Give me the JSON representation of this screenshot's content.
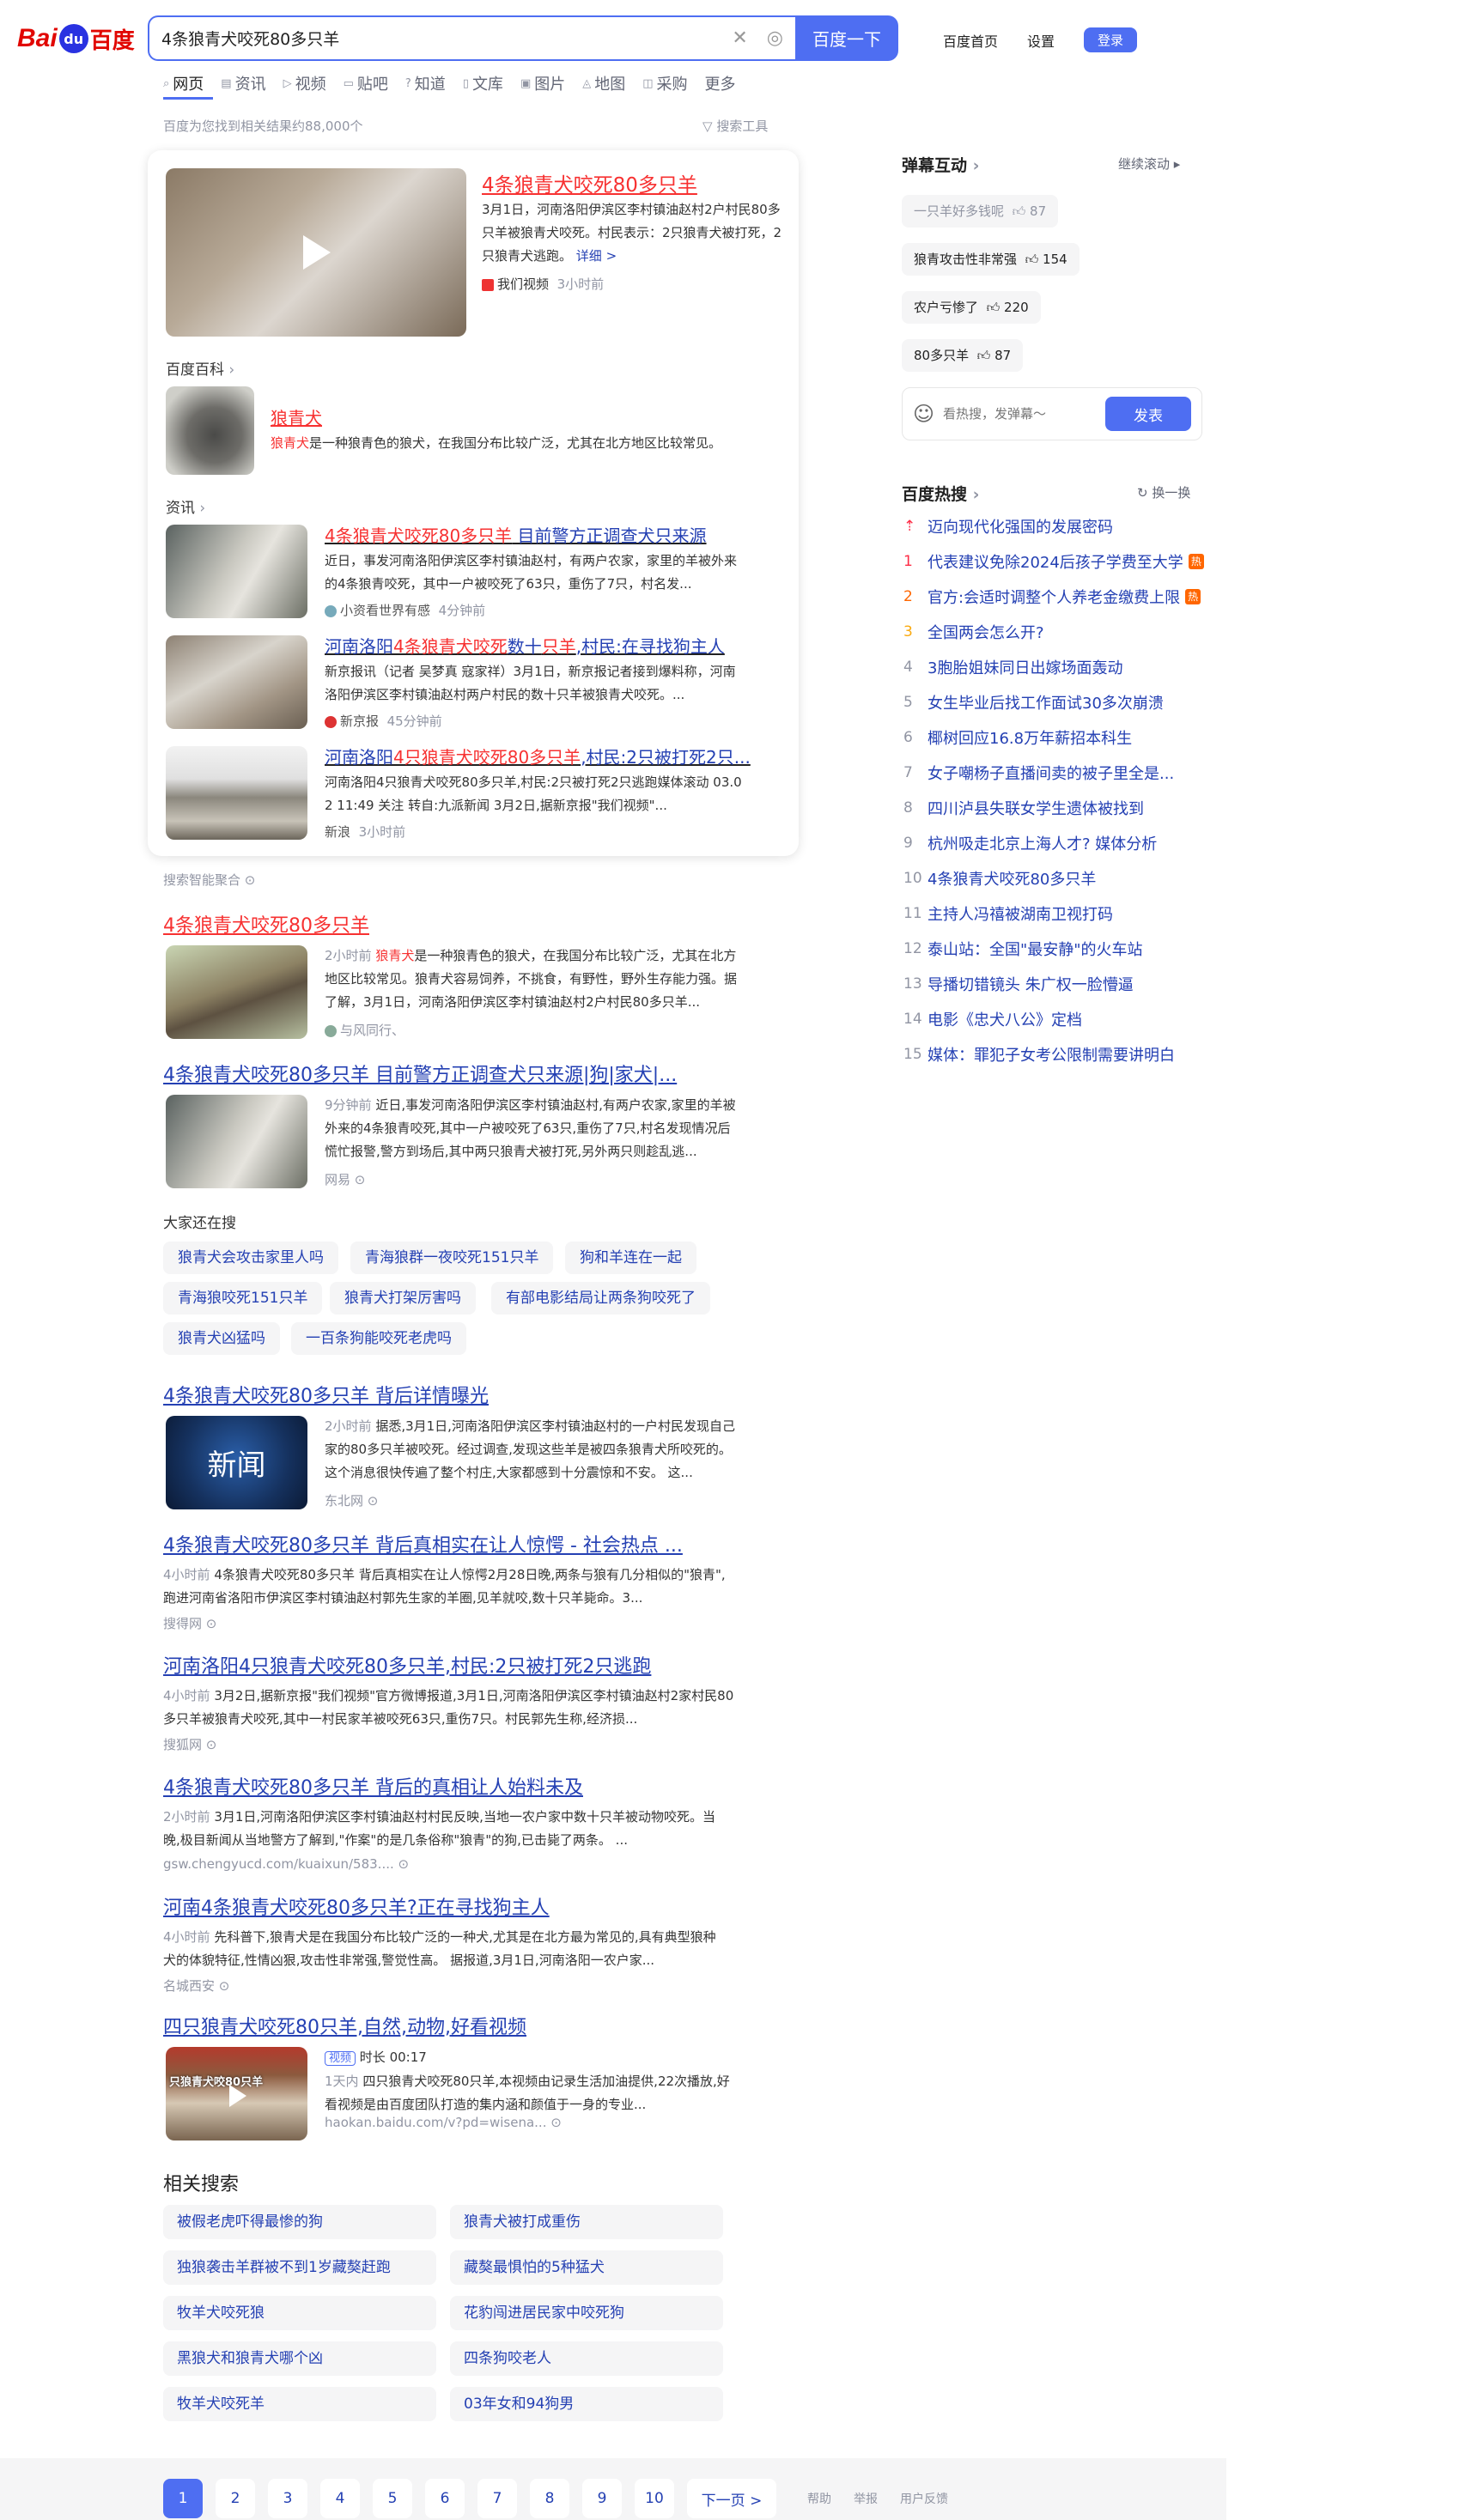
{
  "header": {
    "logo_text": "百度",
    "search_value": "4条狼青犬咬死80多只羊",
    "search_button": "百度一下",
    "links": [
      "百度首页",
      "设置"
    ],
    "login": "登录"
  },
  "tabs": [
    {
      "label": "网页",
      "icon": "search-icon",
      "active": true
    },
    {
      "label": "资讯",
      "icon": "news-icon"
    },
    {
      "label": "视频",
      "icon": "video-icon"
    },
    {
      "label": "贴吧",
      "icon": "tieba-icon"
    },
    {
      "label": "知道",
      "icon": "zhidao-icon"
    },
    {
      "label": "文库",
      "icon": "wenku-icon"
    },
    {
      "label": "图片",
      "icon": "image-icon"
    },
    {
      "label": "地图",
      "icon": "map-icon"
    },
    {
      "label": "采购",
      "icon": "cart-icon"
    },
    {
      "label": "更多",
      "icon": ""
    }
  ],
  "result_count": "百度为您找到相关结果约88,000个",
  "search_tools": "搜索工具",
  "top_card": {
    "video_title": "4条狼青犬咬死80多只羊",
    "video_desc": "3月1日，河南洛阳伊滨区李村镇油赵村2户村民80多只羊被狼青犬咬死。村民表示：2只狼青犬被打死，2只狼青犬逃跑。",
    "video_more": "详细 >",
    "video_source": "我们视频",
    "video_time": "3小时前",
    "baike_label": "百度百科",
    "baike_title": "狼青犬",
    "baike_desc_kw": "狼青犬",
    "baike_desc": "是一种狼青色的狼犬，在我国分布比较广泛，尤其在北方地区比较常见。",
    "news_label": "资讯",
    "news": [
      {
        "title_red": "4条狼青犬咬死80多只羊",
        "title_rest": " 目前警方正调查犬只来源",
        "line1": "近日，事发河南洛阳伊滨区李村镇油赵村，有两户农家，家里的羊被外来",
        "line2": "的4条狼青咬死，其中一户被咬死了63只，重伤了7只，村名发...",
        "source": "小资看世界有感",
        "time": "4分钟前"
      },
      {
        "title_pre": "河南洛阳",
        "title_red": "4条狼青犬咬死",
        "title_mid": "数十",
        "title_red2": "只羊",
        "title_rest": ",村民:在寻找狗主人",
        "line1": "新京报讯（记者 吴梦真 寇家祥）3月1日，新京报记者接到爆料称，河南",
        "line2": "洛阳伊滨区李村镇油赵村两户村民的数十只羊被狼青犬咬死。...",
        "source": "新京报",
        "time": "45分钟前"
      },
      {
        "title_pre": "河南洛阳",
        "title_red": "4只狼青犬咬死80多只羊",
        "title_rest": ",村民:2只被打死2只...",
        "line1": "河南洛阳4只狼青犬咬死80多只羊,村民:2只被打死2只逃跑媒体滚动 03.0",
        "line2": "2 11:49 关注 转自:九派新闻 3月2日,据新京报\"我们视频\"...",
        "source": "新浪",
        "time": "3小时前"
      }
    ]
  },
  "smart_label": "搜索智能聚合",
  "results": [
    {
      "title": "4条狼青犬咬死80多只羊",
      "line1_time": "2小时前",
      "line1_kw": "狼青犬",
      "line1": "是一种狼青色的狼犬，在我国分布比较广泛，尤其在北方",
      "line2": "地区比较常见。狼青犬容易饲养，不挑食，有野性，野外生存能力强。据",
      "line3": "了解，3月1日，河南洛阳伊滨区李村镇油赵村2户村民80多只羊...",
      "source": "与风同行、"
    },
    {
      "title": "4条狼青犬咬死80多只羊 目前警方正调查犬只来源|狗|家犬|...",
      "line1_time": "9分钟前",
      "line1": "近日,事发河南洛阳伊滨区李村镇油赵村,有两户农家,家里的羊被",
      "line2": "外来的4条狼青咬死,其中一户被咬死了63只,重伤了7只,村名发现情况后",
      "line3": "慌忙报警,警方到场后,其中两只狼青犬被打死,另外两只则趁乱逃...",
      "source": "网易"
    }
  ],
  "also_search_label": "大家还在搜",
  "also_search": [
    "狼青犬会攻击家里人吗",
    "青海狼群一夜咬死151只羊",
    "狗和羊连在一起",
    "青海狼咬死151只羊",
    "狼青犬打架厉害吗",
    "有部电影结局让两条狗咬死了",
    "狼青犬凶猛吗",
    "一百条狗能咬死老虎吗"
  ],
  "results2": [
    {
      "title": "4条狼青犬咬死80多只羊 背后详情曝光",
      "time": "2小时前",
      "line1": "据悉,3月1日,河南洛阳伊滨区李村镇油赵村的一户村民发现自己",
      "line2": "家的80多只羊被咬死。经过调查,发现这些羊是被四条狼青犬所咬死的。",
      "line3": "这个消息很快传遍了整个村庄,大家都感到十分震惊和不安。 这...",
      "source": "东北网",
      "thumb_text": "新闻"
    },
    {
      "title": "4条狼青犬咬死80多只羊 背后真相实在让人惊愕 - 社会热点 ...",
      "time": "4小时前",
      "line1": "4条狼青犬咬死80多只羊 背后真相实在让人惊愕2月28日晚,两条与狼有几分相似的\"狼青\",",
      "line2": "跑进河南省洛阳市伊滨区李村镇油赵村郭先生家的羊圈,见羊就咬,数十只羊毙命。3...",
      "source": "搜得网"
    },
    {
      "title": "河南洛阳4只狼青犬咬死80多只羊,村民:2只被打死2只逃跑",
      "time": "4小时前",
      "line1": "3月2日,据新京报\"我们视频\"官方微博报道,3月1日,河南洛阳伊滨区李村镇油赵村2家村民80",
      "line2": "多只羊被狼青犬咬死,其中一村民家羊被咬死63只,重伤7只。村民郭先生称,经济损...",
      "source": "搜狐网"
    },
    {
      "title": "4条狼青犬咬死80多只羊 背后的真相让人始料未及",
      "time": "2小时前",
      "line1": "3月1日,河南洛阳伊滨区李村镇油赵村村民反映,当地一农户家中数十只羊被动物咬死。当",
      "line2": "晚,极目新闻从当地警方了解到,\"作案\"的是几条俗称\"狼青\"的狗,已击毙了两条。 ...",
      "source": "gsw.chengyucd.com/kuaixun/583...."
    },
    {
      "title": "河南4条狼青犬咬死80多只羊?正在寻找狗主人",
      "time": "4小时前",
      "line1": "先科普下,狼青犬是在我国分布比较广泛的一种犬,尤其是在北方最为常见的,具有典型狼种",
      "line2": "犬的体貌特征,性情凶狠,攻击性非常强,警觉性高。 据报道,3月1日,河南洛阳一农户家...",
      "source": "名城西安"
    },
    {
      "title": "四只狼青犬咬死80只羊,自然,动物,好看视频",
      "video_label": "视频",
      "duration": "时长 00:17",
      "time": "1天内",
      "line1": "四只狼青犬咬死80只羊,本视频由记录生活加油提供,22次播放,好",
      "line2": "看视频是由百度团队打造的集内涵和颜值于一身的专业...",
      "source": "haokan.baidu.com/v?pd=wisena...",
      "thumb_text": "只狼青犬咬80只羊"
    }
  ],
  "related_label": "相关搜索",
  "related": [
    "被假老虎吓得最惨的狗",
    "狼青犬被打成重伤",
    "独狼袭击羊群被不到1岁藏獒赶跑",
    "藏獒最惧怕的5种猛犬",
    "牧羊犬咬死狼",
    "花豹闯进居民家中咬死狗",
    "黑狼犬和狼青犬哪个凶",
    "四条狗咬老人",
    "牧羊犬咬死羊",
    "03年女和94狗男"
  ],
  "pagination": [
    "1",
    "2",
    "3",
    "4",
    "5",
    "6",
    "7",
    "8",
    "9",
    "10"
  ],
  "next_page": "下一页 >",
  "footer": [
    "帮助",
    "举报",
    "用户反馈"
  ],
  "danmu": {
    "title": "弹幕互动",
    "continue": "继续滚动",
    "items": [
      {
        "text": "一只羊好多钱呢",
        "likes": "87"
      },
      {
        "text": "狼青攻击性非常强",
        "likes": "154"
      },
      {
        "text": "农户亏惨了",
        "likes": "220"
      },
      {
        "text": "80多只羊",
        "likes": "87"
      }
    ],
    "input_placeholder": "看热搜，发弹幕～",
    "send": "发表"
  },
  "hot": {
    "title": "百度热搜",
    "refresh": "换一换",
    "items": [
      {
        "rank": "top",
        "text": "迈向现代化强国的发展密码"
      },
      {
        "rank": "1",
        "text": "代表建议免除2024后孩子学费至大学",
        "badge": "热"
      },
      {
        "rank": "2",
        "text": "官方:会适时调整个人养老金缴费上限",
        "badge": "热"
      },
      {
        "rank": "3",
        "text": "全国两会怎么开?"
      },
      {
        "rank": "4",
        "text": "3胞胎姐妹同日出嫁场面轰动"
      },
      {
        "rank": "5",
        "text": "女生毕业后找工作面试30多次崩溃"
      },
      {
        "rank": "6",
        "text": "椰树回应16.8万年薪招本科生"
      },
      {
        "rank": "7",
        "text": "女子嘲杨子直播间卖的被子里全是..."
      },
      {
        "rank": "8",
        "text": "四川泸县失联女学生遗体被找到"
      },
      {
        "rank": "9",
        "text": "杭州吸走北京上海人才? 媒体分析"
      },
      {
        "rank": "10",
        "text": "4条狼青犬咬死80多只羊"
      },
      {
        "rank": "11",
        "text": "主持人冯禧被湖南卫视打码"
      },
      {
        "rank": "12",
        "text": "泰山站：全国\"最安静\"的火车站"
      },
      {
        "rank": "13",
        "text": "导播切错镜头 朱广权一脸懵逼"
      },
      {
        "rank": "14",
        "text": "电影《忠犬八公》定档"
      },
      {
        "rank": "15",
        "text": "媒体：罪犯子女考公限制需要讲明白"
      }
    ]
  },
  "colors": {
    "brand_blue": "#4e6ef2",
    "link_blue": "#2440b3",
    "highlight_red": "#f73131",
    "rank_red": "#fe2d46",
    "rank_orange": "#ff6600",
    "rank_yellow": "#faa90e"
  }
}
